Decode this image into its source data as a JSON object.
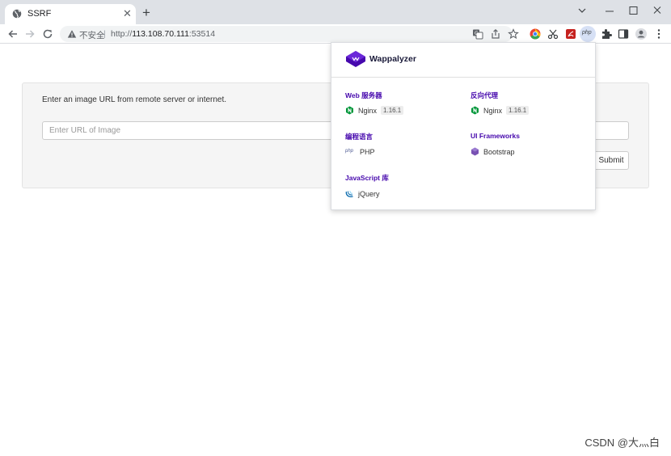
{
  "tab": {
    "title": "SSRF",
    "close": "✕",
    "new_tab": "+"
  },
  "omnibox": {
    "security_label": "不安全",
    "separator": "|",
    "url_scheme": "http://",
    "url_host": "113.108.70.111",
    "url_port": ":53514"
  },
  "page": {
    "instruction": "Enter an image URL from remote server or internet.",
    "input_placeholder": "Enter URL of Image",
    "submit_label": "Submit"
  },
  "wappalyzer": {
    "name": "Wappalyzer",
    "categories": [
      {
        "label": "Web 服务器",
        "tech": "Nginx",
        "version": "1.16.1"
      },
      {
        "label": "反向代理",
        "tech": "Nginx",
        "version": "1.16.1"
      },
      {
        "label": "编程语言",
        "tech": "PHP",
        "version": ""
      },
      {
        "label": "UI Frameworks",
        "tech": "Bootstrap",
        "version": ""
      },
      {
        "label": "JavaScript 库",
        "tech": "jQuery",
        "version": ""
      }
    ],
    "php_icon_text": "php"
  },
  "watermark": "CSDN @大灬白",
  "colors": {
    "wappalyzer_purple": "#4608ad",
    "nginx_green": "#009639",
    "bootstrap_purple": "#7952b3",
    "jquery_blue": "#0769ad"
  }
}
